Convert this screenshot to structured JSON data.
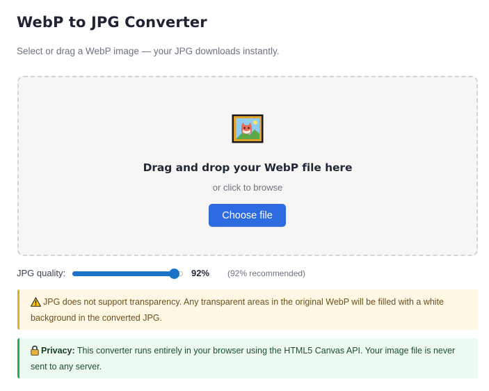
{
  "header": {
    "title": "WebP to JPG Converter",
    "subtitle": "Select or drag a WebP image — your JPG downloads instantly."
  },
  "dropzone": {
    "icon": "framed-picture-icon",
    "title": "Drag and drop your WebP file here",
    "subtitle": "or click to browse",
    "button_label": "Choose file",
    "accent_color": "#2f6be0"
  },
  "quality": {
    "label": "JPG quality:",
    "value": 92,
    "min": 0,
    "max": 100,
    "value_text": "92%",
    "recommendation": "(92% recommended)"
  },
  "notices": {
    "transparency": {
      "icon": "warning-icon",
      "text": "JPG does not support transparency. Any transparent areas in the original WebP will be filled with a white background in the converted JPG."
    },
    "privacy": {
      "icon": "lock-icon",
      "heading": "Privacy:",
      "text": "This converter runs entirely in your browser using the HTML5 Canvas API. Your image file is never sent to any server."
    }
  }
}
